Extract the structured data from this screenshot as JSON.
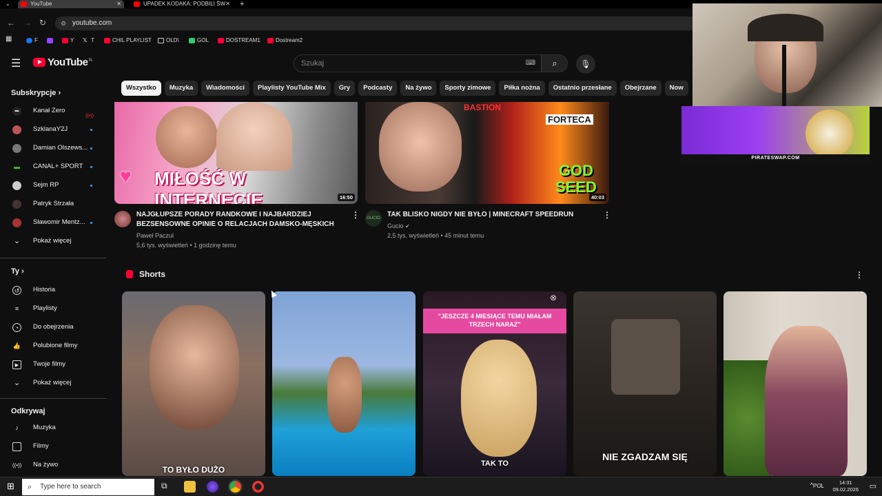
{
  "browser": {
    "tabs": [
      {
        "title": "YouTube"
      },
      {
        "title": "UPADEK KODAKA: PODBILI ŚW"
      }
    ],
    "new_tab": "+",
    "url": "youtube.com",
    "bookmarks": [
      "F",
      "Y",
      "T",
      "CHIL PLAYLIST",
      "OLD\\",
      "GOL",
      "DOSTREAM1",
      "Dostream2"
    ]
  },
  "header": {
    "logo": "YouTube",
    "region": "PL",
    "search_placeholder": "Szukaj"
  },
  "sidebar": {
    "subscriptions_title": "Subskrypcje",
    "subscriptions": [
      {
        "name": "Kanał Zero",
        "live": true
      },
      {
        "name": "SzklanaY2J",
        "dot": true
      },
      {
        "name": "Damian Olszews...",
        "dot": true
      },
      {
        "name": "CANAL+ SPORT",
        "dot": true
      },
      {
        "name": "Sejm RP",
        "dot": true
      },
      {
        "name": "Patryk Strzała",
        "dot": false
      },
      {
        "name": "Sławomir Mentz...",
        "dot": true
      }
    ],
    "show_more": "Pokaż więcej",
    "you_title": "Ty",
    "you_items": [
      "Historia",
      "Playlisty",
      "Do obejrzenia",
      "Polubione filmy",
      "Twoje filmy",
      "Pokaż więcej"
    ],
    "explore_title": "Odkrywaj",
    "explore_items": [
      "Muzyka",
      "Filmy",
      "Na żywo"
    ]
  },
  "chips": [
    "Wszystko",
    "Muzyka",
    "Wiadomości",
    "Playlisty YouTube Mix",
    "Gry",
    "Podcasty",
    "Na żywo",
    "Sporty zimowe",
    "Piłka nożna",
    "Ostatnio przesłane",
    "Obejrzane",
    "Now"
  ],
  "videos": [
    {
      "thumb_text": "MIŁOŚĆ W INTERNECIE",
      "duration": "16:50",
      "title": "NAJGŁUPSZE PORADY RANDKOWE I NAJBARDZIEJ BEZSENSOWNE OPINIE O RELACJACH DAMSKO-MĘSKICH",
      "channel": "Paweł Paczul",
      "meta": "5,6 tys. wyświetleń • 1 godzinę temu"
    },
    {
      "thumb_text_top": "BASTION",
      "thumb_text_mid": "FORTECA",
      "thumb_text_big": "GOD SEED",
      "duration": "40:03",
      "title": "TAK BLISKO NIGDY NIE BYŁO | MINECRAFT SPEEDRUN",
      "channel": "Gucio",
      "channel_avatar": "GUCIO",
      "meta": "2,5 tys. wyświetleń • 45 minut temu"
    }
  ],
  "shorts": {
    "title": "Shorts",
    "items": [
      {
        "caption": "TO BYŁO DUŻO"
      },
      {
        "caption": ""
      },
      {
        "caption_top": "\"JESZCZE 4 MIESIĄCE TEMU MIAŁAM TRZECH NARAZ\"",
        "caption": "TAK TO"
      },
      {
        "caption": "NIE ZGADZAM SIĘ"
      },
      {
        "caption": ""
      }
    ]
  },
  "ad": {
    "text": "PIRATESWAP.COM"
  },
  "taskbar": {
    "search_placeholder": "Type here to search",
    "lang": "POL",
    "time": "14:31",
    "date": "09.02.2026"
  }
}
